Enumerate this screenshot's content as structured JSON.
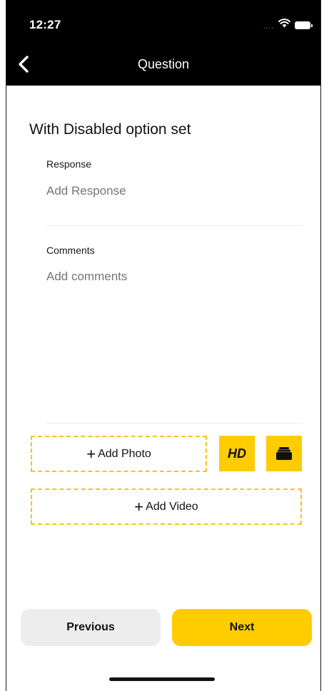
{
  "status_bar": {
    "time": "12:27",
    "signal": "....",
    "icons": [
      "wifi-icon",
      "battery-icon"
    ]
  },
  "nav": {
    "back_icon": "chevron-left-icon",
    "title": "Question"
  },
  "question": {
    "title": "With Disabled option set"
  },
  "response": {
    "label": "Response",
    "placeholder": "Add Response"
  },
  "comments": {
    "label": "Comments",
    "placeholder": "Add comments"
  },
  "media": {
    "add_photo_label": "Add Photo",
    "add_video_label": "Add Video",
    "plus_symbol": "+",
    "hd_label": "HD",
    "gallery_icon": "photo-stack-icon"
  },
  "footer": {
    "previous_label": "Previous",
    "next_label": "Next"
  },
  "colors": {
    "header_bg": "#000000",
    "accent_yellow": "#ffcc00",
    "dashed_border": "#f5c518",
    "previous_bg": "#ededed",
    "placeholder": "#a6a6a6"
  }
}
